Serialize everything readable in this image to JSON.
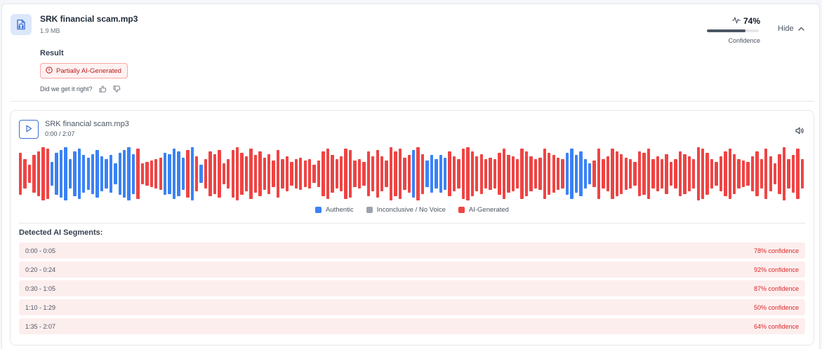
{
  "file": {
    "name": "SRK financial scam.mp3",
    "size": "1.9 MB",
    "icon": "audio-file-icon"
  },
  "confidence": {
    "value": "74%",
    "fraction": 0.74,
    "label": "Confidence",
    "icon": "activity-pulse-icon"
  },
  "hide_button": {
    "label": "Hide",
    "icon": "chevron-up-icon"
  },
  "result": {
    "label": "Result",
    "badge": "Partially AI-Generated",
    "badge_icon": "alert-circle-icon",
    "feedback_prompt": "Did we get it right?"
  },
  "player": {
    "title": "SRK financial scam.mp3",
    "time": "0:00 / 2:07",
    "play_icon": "play-icon",
    "volume_icon": "volume-icon"
  },
  "colors": {
    "authentic": "#3b82f6",
    "inconclusive": "#9ca3af",
    "ai": "#ef4444",
    "accent": "#3b6fd1"
  },
  "legend": [
    {
      "label": "Authentic",
      "color": "#3b82f6"
    },
    {
      "label": "Inconclusive / No Voice",
      "color": "#9ca3af"
    },
    {
      "label": "AI-Generated",
      "color": "#ef4444"
    }
  ],
  "waveform": {
    "bars": [
      [
        0.8,
        "ai"
      ],
      [
        0.55,
        "ai"
      ],
      [
        0.35,
        "ai"
      ],
      [
        0.7,
        "ai"
      ],
      [
        0.85,
        "ai"
      ],
      [
        1.0,
        "ai"
      ],
      [
        0.95,
        "ai"
      ],
      [
        0.45,
        "authentic"
      ],
      [
        0.8,
        "authentic"
      ],
      [
        0.9,
        "authentic"
      ],
      [
        1.0,
        "authentic"
      ],
      [
        0.55,
        "authentic"
      ],
      [
        0.85,
        "authentic"
      ],
      [
        0.95,
        "authentic"
      ],
      [
        0.7,
        "authentic"
      ],
      [
        0.6,
        "authentic"
      ],
      [
        0.75,
        "authentic"
      ],
      [
        0.9,
        "authentic"
      ],
      [
        0.65,
        "authentic"
      ],
      [
        0.55,
        "authentic"
      ],
      [
        0.7,
        "authentic"
      ],
      [
        0.4,
        "authentic"
      ],
      [
        0.8,
        "authentic"
      ],
      [
        0.9,
        "authentic"
      ],
      [
        1.0,
        "authentic"
      ],
      [
        0.75,
        "authentic"
      ],
      [
        0.95,
        "ai"
      ],
      [
        0.4,
        "ai"
      ],
      [
        0.45,
        "ai"
      ],
      [
        0.5,
        "ai"
      ],
      [
        0.55,
        "ai"
      ],
      [
        0.6,
        "ai"
      ],
      [
        0.8,
        "authentic"
      ],
      [
        0.75,
        "authentic"
      ],
      [
        0.95,
        "authentic"
      ],
      [
        0.85,
        "authentic"
      ],
      [
        0.6,
        "authentic"
      ],
      [
        0.9,
        "ai"
      ],
      [
        1.0,
        "authentic"
      ],
      [
        0.65,
        "ai"
      ],
      [
        0.35,
        "authentic"
      ],
      [
        0.55,
        "ai"
      ],
      [
        0.85,
        "ai"
      ],
      [
        0.75,
        "ai"
      ],
      [
        0.9,
        "ai"
      ],
      [
        0.4,
        "ai"
      ],
      [
        0.55,
        "ai"
      ],
      [
        0.9,
        "ai"
      ],
      [
        1.0,
        "ai"
      ],
      [
        0.8,
        "ai"
      ],
      [
        0.65,
        "ai"
      ],
      [
        0.95,
        "ai"
      ],
      [
        0.7,
        "ai"
      ],
      [
        0.85,
        "ai"
      ],
      [
        0.6,
        "ai"
      ],
      [
        0.75,
        "ai"
      ],
      [
        0.5,
        "ai"
      ],
      [
        0.9,
        "ai"
      ],
      [
        0.55,
        "ai"
      ],
      [
        0.65,
        "ai"
      ],
      [
        0.45,
        "ai"
      ],
      [
        0.55,
        "ai"
      ],
      [
        0.6,
        "ai"
      ],
      [
        0.5,
        "ai"
      ],
      [
        0.55,
        "ai"
      ],
      [
        0.35,
        "ai"
      ],
      [
        0.5,
        "ai"
      ],
      [
        0.85,
        "ai"
      ],
      [
        0.95,
        "ai"
      ],
      [
        0.7,
        "ai"
      ],
      [
        0.55,
        "ai"
      ],
      [
        0.65,
        "ai"
      ],
      [
        0.95,
        "ai"
      ],
      [
        0.9,
        "ai"
      ],
      [
        0.5,
        "ai"
      ],
      [
        0.55,
        "ai"
      ],
      [
        0.45,
        "ai"
      ],
      [
        0.85,
        "ai"
      ],
      [
        0.65,
        "ai"
      ],
      [
        0.9,
        "ai"
      ],
      [
        0.65,
        "ai"
      ],
      [
        0.5,
        "ai"
      ],
      [
        1.0,
        "ai"
      ],
      [
        0.85,
        "ai"
      ],
      [
        0.95,
        "ai"
      ],
      [
        0.6,
        "ai"
      ],
      [
        0.7,
        "ai"
      ],
      [
        0.9,
        "authentic"
      ],
      [
        1.0,
        "ai"
      ],
      [
        0.75,
        "ai"
      ],
      [
        0.5,
        "authentic"
      ],
      [
        0.7,
        "authentic"
      ],
      [
        0.55,
        "authentic"
      ],
      [
        0.7,
        "authentic"
      ],
      [
        0.6,
        "authentic"
      ],
      [
        0.85,
        "ai"
      ],
      [
        0.65,
        "ai"
      ],
      [
        0.55,
        "ai"
      ],
      [
        0.95,
        "ai"
      ],
      [
        1.0,
        "ai"
      ],
      [
        0.85,
        "ai"
      ],
      [
        0.65,
        "ai"
      ],
      [
        0.75,
        "ai"
      ],
      [
        0.55,
        "ai"
      ],
      [
        0.6,
        "ai"
      ],
      [
        0.55,
        "ai"
      ],
      [
        0.8,
        "ai"
      ],
      [
        0.95,
        "ai"
      ],
      [
        0.7,
        "ai"
      ],
      [
        0.65,
        "ai"
      ],
      [
        0.55,
        "ai"
      ],
      [
        0.95,
        "ai"
      ],
      [
        0.85,
        "ai"
      ],
      [
        0.65,
        "ai"
      ],
      [
        0.55,
        "ai"
      ],
      [
        0.6,
        "ai"
      ],
      [
        0.95,
        "ai"
      ],
      [
        0.8,
        "ai"
      ],
      [
        0.7,
        "ai"
      ],
      [
        0.6,
        "ai"
      ],
      [
        0.55,
        "ai"
      ],
      [
        0.8,
        "authentic"
      ],
      [
        0.95,
        "authentic"
      ],
      [
        0.7,
        "authentic"
      ],
      [
        0.85,
        "authentic"
      ],
      [
        0.55,
        "authentic"
      ],
      [
        0.4,
        "authentic"
      ],
      [
        0.5,
        "ai"
      ],
      [
        0.95,
        "ai"
      ],
      [
        0.55,
        "ai"
      ],
      [
        0.65,
        "ai"
      ],
      [
        0.95,
        "ai"
      ],
      [
        0.85,
        "ai"
      ],
      [
        0.75,
        "ai"
      ],
      [
        0.6,
        "ai"
      ],
      [
        0.55,
        "ai"
      ],
      [
        0.45,
        "ai"
      ],
      [
        0.85,
        "ai"
      ],
      [
        0.8,
        "ai"
      ],
      [
        0.95,
        "ai"
      ],
      [
        0.55,
        "ai"
      ],
      [
        0.65,
        "ai"
      ],
      [
        0.55,
        "ai"
      ],
      [
        0.75,
        "ai"
      ],
      [
        0.45,
        "ai"
      ],
      [
        0.55,
        "ai"
      ],
      [
        0.85,
        "ai"
      ],
      [
        0.75,
        "ai"
      ],
      [
        0.65,
        "ai"
      ],
      [
        0.55,
        "ai"
      ],
      [
        1.0,
        "ai"
      ],
      [
        0.95,
        "ai"
      ],
      [
        0.8,
        "ai"
      ],
      [
        0.55,
        "ai"
      ],
      [
        0.45,
        "ai"
      ],
      [
        0.65,
        "ai"
      ],
      [
        0.85,
        "ai"
      ],
      [
        0.95,
        "ai"
      ],
      [
        0.75,
        "ai"
      ],
      [
        0.55,
        "ai"
      ],
      [
        0.5,
        "ai"
      ],
      [
        0.45,
        "ai"
      ],
      [
        0.65,
        "ai"
      ],
      [
        0.85,
        "ai"
      ],
      [
        0.55,
        "ai"
      ],
      [
        0.95,
        "ai"
      ],
      [
        0.65,
        "ai"
      ],
      [
        0.4,
        "ai"
      ],
      [
        0.75,
        "ai"
      ],
      [
        1.0,
        "ai"
      ],
      [
        0.55,
        "ai"
      ],
      [
        0.7,
        "ai"
      ],
      [
        0.95,
        "ai"
      ],
      [
        0.55,
        "ai"
      ]
    ]
  },
  "segments": {
    "title": "Detected AI Segments:",
    "rows": [
      {
        "time": "0:00 - 0:05",
        "confidence": "78% confidence"
      },
      {
        "time": "0:20 - 0:24",
        "confidence": "92% confidence"
      },
      {
        "time": "0:30 - 1:05",
        "confidence": "87% confidence"
      },
      {
        "time": "1:10 - 1:29",
        "confidence": "50% confidence"
      },
      {
        "time": "1:35 - 2:07",
        "confidence": "64% confidence"
      }
    ]
  }
}
